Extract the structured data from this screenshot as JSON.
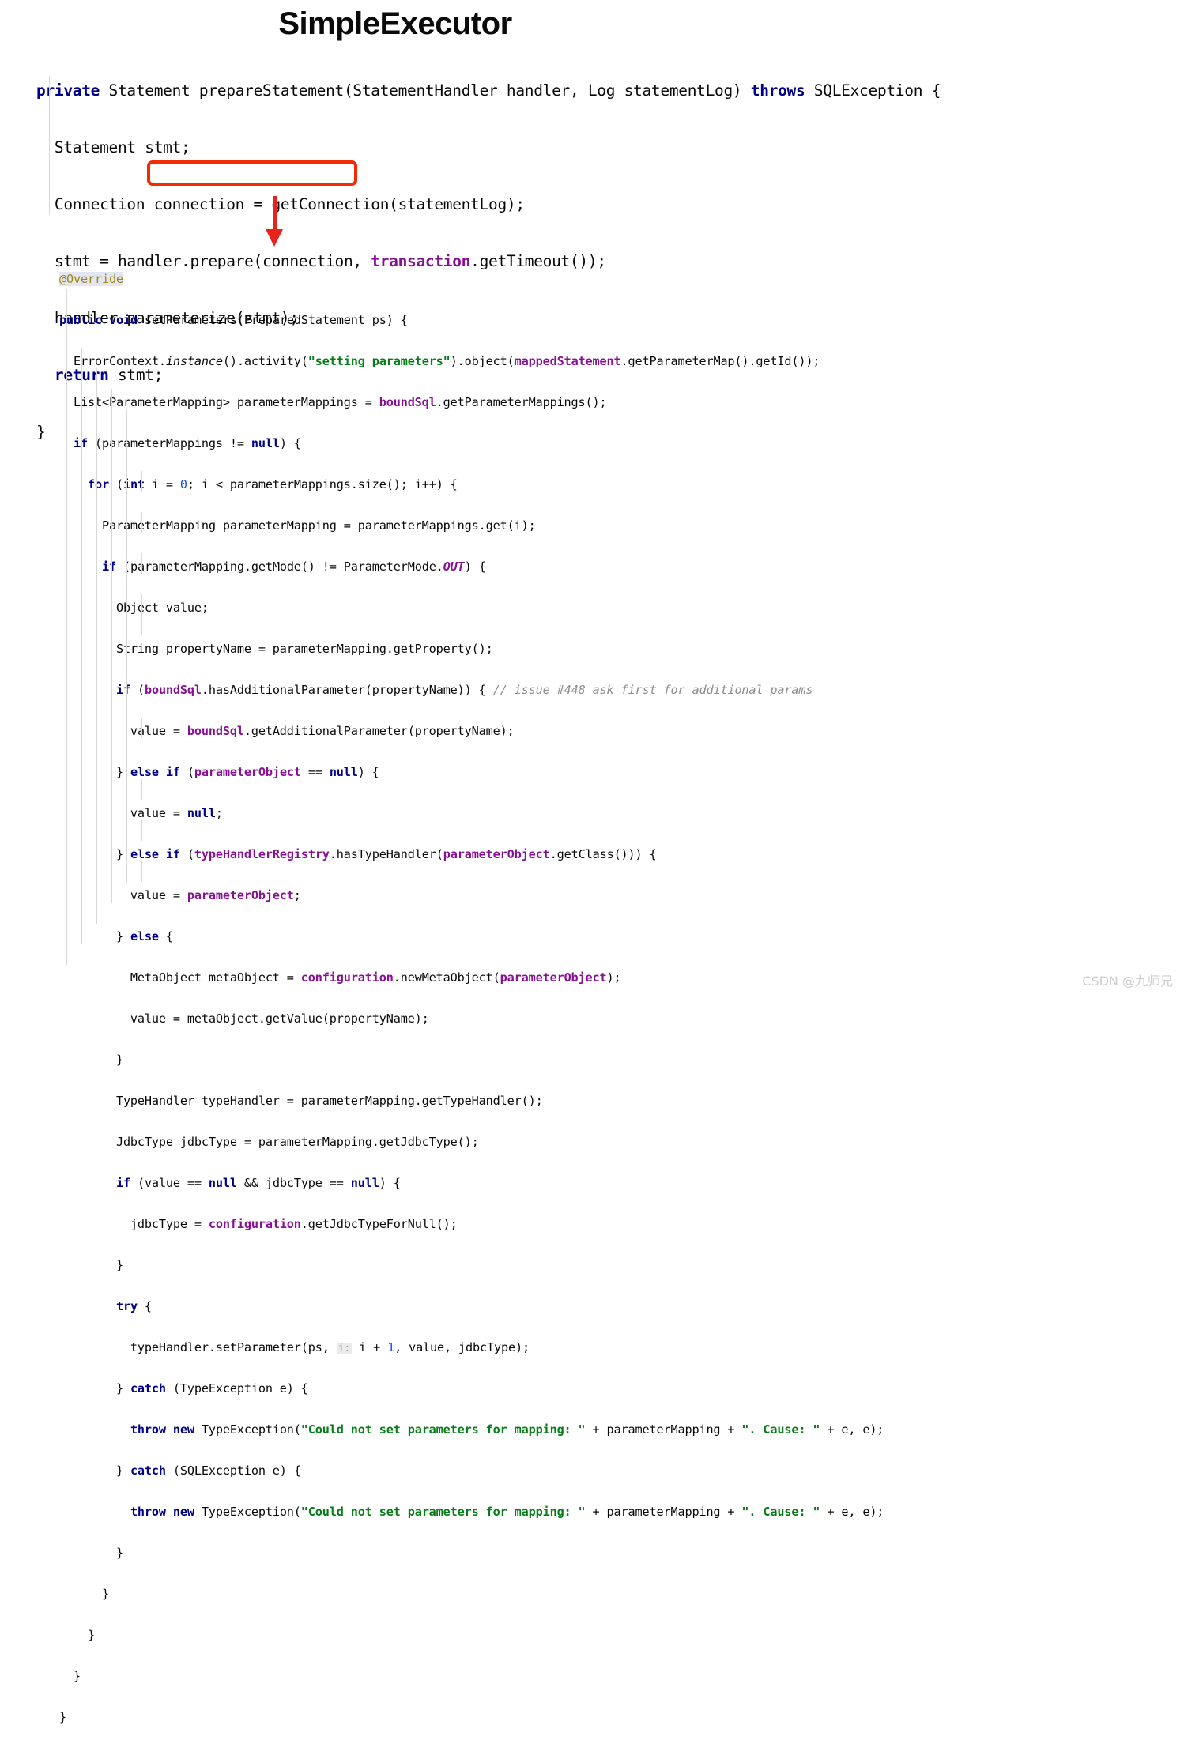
{
  "page": {
    "title": "SimpleExecutor",
    "watermark": "CSDN @九师兄"
  },
  "colors": {
    "keyword": "#000086",
    "field": "#871094",
    "string": "#067d17",
    "number": "#1750eb",
    "comment": "#8c8c8c",
    "annotation": "#9e880d",
    "highlight_box": "#f42b00",
    "arrow": "#e8231b",
    "text": "#080808",
    "background": "#ffffff"
  },
  "annotation": {
    "highlighted_code": "parameterize(stmt)",
    "arrow_direction": "down"
  },
  "code_block_top": {
    "language": "java",
    "lines": [
      "private Statement prepareStatement(StatementHandler handler, Log statementLog) throws SQLException {",
      "  Statement stmt;",
      "  Connection connection = getConnection(statementLog);",
      "  stmt = handler.prepare(connection, transaction.getTimeout());",
      "  handler.parameterize(stmt);",
      "  return stmt;",
      "}"
    ]
  },
  "code_block_bottom": {
    "language": "java",
    "lines": [
      "@Override",
      "public void setParameters(PreparedStatement ps) {",
      "  ErrorContext.instance().activity(\"setting parameters\").object(mappedStatement.getParameterMap().getId());",
      "  List<ParameterMapping> parameterMappings = boundSql.getParameterMappings();",
      "  if (parameterMappings != null) {",
      "    for (int i = 0; i < parameterMappings.size(); i++) {",
      "      ParameterMapping parameterMapping = parameterMappings.get(i);",
      "      if (parameterMapping.getMode() != ParameterMode.OUT) {",
      "        Object value;",
      "        String propertyName = parameterMapping.getProperty();",
      "        if (boundSql.hasAdditionalParameter(propertyName)) { // issue #448 ask first for additional params",
      "          value = boundSql.getAdditionalParameter(propertyName);",
      "        } else if (parameterObject == null) {",
      "          value = null;",
      "        } else if (typeHandlerRegistry.hasTypeHandler(parameterObject.getClass())) {",
      "          value = parameterObject;",
      "        } else {",
      "          MetaObject metaObject = configuration.newMetaObject(parameterObject);",
      "          value = metaObject.getValue(propertyName);",
      "        }",
      "        TypeHandler typeHandler = parameterMapping.getTypeHandler();",
      "        JdbcType jdbcType = parameterMapping.getJdbcType();",
      "        if (value == null && jdbcType == null) {",
      "          jdbcType = configuration.getJdbcTypeForNull();",
      "        }",
      "        try {",
      "          typeHandler.setParameter(ps, i: i + 1, value, jdbcType);",
      "        } catch (TypeException e) {",
      "          throw new TypeException(\"Could not set parameters for mapping: \" + parameterMapping + \". Cause: \" + e, e);",
      "        } catch (SQLException e) {",
      "          throw new TypeException(\"Could not set parameters for mapping: \" + parameterMapping + \". Cause: \" + e, e);",
      "        }",
      "      }",
      "    }",
      "  }",
      "}"
    ],
    "inline_hint": "i:"
  }
}
